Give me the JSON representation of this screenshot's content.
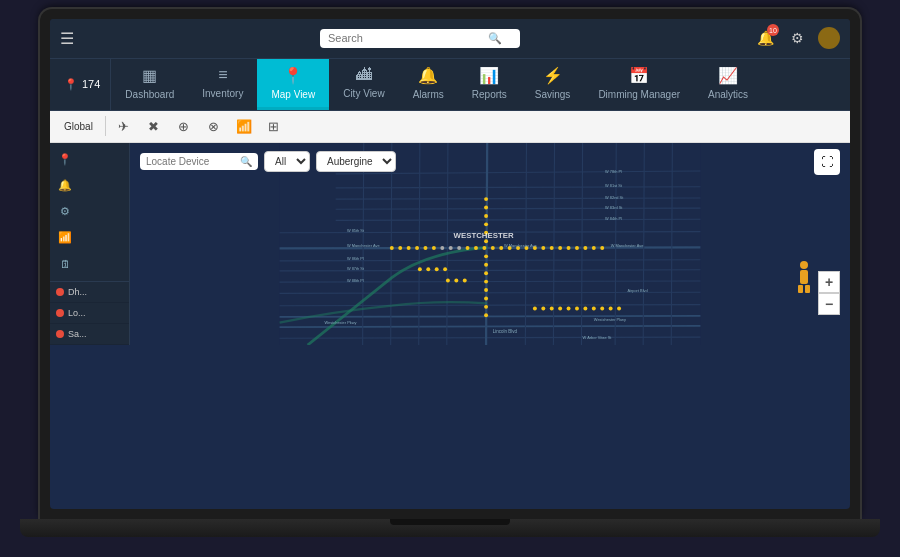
{
  "topbar": {
    "menu_icon": "☰",
    "search_placeholder": "Search",
    "notification_count": "10",
    "icons": [
      "🔍",
      "🔔",
      "⚙",
      "👤"
    ]
  },
  "navtabs": [
    {
      "id": "dashboard",
      "label": "Dashboard",
      "icon": "▦",
      "active": false
    },
    {
      "id": "inventory",
      "label": "Inventory",
      "icon": "≡",
      "active": false
    },
    {
      "id": "mapview",
      "label": "Map View",
      "icon": "📍",
      "active": true
    },
    {
      "id": "cityview",
      "label": "City View",
      "icon": "≡",
      "active": false
    },
    {
      "id": "alarms",
      "label": "Alarms",
      "icon": "🔔",
      "active": false
    },
    {
      "id": "reports",
      "label": "Reports",
      "icon": "📊",
      "active": false
    },
    {
      "id": "savings",
      "label": "Savings",
      "icon": "⚡",
      "active": false
    },
    {
      "id": "dimming",
      "label": "Dimming Manager",
      "icon": "📅",
      "active": false
    },
    {
      "id": "analytics",
      "label": "Analytics",
      "icon": "📈",
      "active": false
    }
  ],
  "location_badge": {
    "icon": "📍",
    "count": "174"
  },
  "toolbar": {
    "global_label": "Global",
    "buttons": [
      "✈",
      "✖",
      "⊕",
      "⊗",
      "📶",
      "⊞"
    ]
  },
  "sidebar": {
    "filter_icons": [
      "📍",
      "🔔",
      "⚙",
      "📶",
      "🗓"
    ],
    "items": [
      {
        "id": "dh",
        "label": "Dh...",
        "color": "#e74c3c"
      },
      {
        "id": "lo",
        "label": "Lo...",
        "color": "#e74c3c"
      },
      {
        "id": "sa",
        "label": "Sa...",
        "color": "#e74c3c"
      }
    ]
  },
  "map": {
    "locate_placeholder": "Locate Device",
    "filter_all_label": "All",
    "filter_color_label": "Aubergine",
    "zoom_in": "+",
    "zoom_out": "−",
    "location_name": "WESTCHESTER",
    "streets": [
      "W 78th Pl",
      "W 81st St",
      "W 82nd St",
      "W 83rd St",
      "W 84th Pl",
      "W 85th St",
      "W Manchester Ave",
      "W 86th Pl",
      "W 87th St",
      "W 88th Pl",
      "Lincoln Blvd",
      "W Arbor Vitae St",
      "Westchester Pkwy",
      "Airport Blvd",
      "Sepulveda Blvd"
    ]
  },
  "colors": {
    "active_tab": "#00bcd4",
    "map_bg": "#1b2a4a",
    "sidebar_bg": "#1e2a3a",
    "street": "#253a5e",
    "street_light": "#2d4a70",
    "dot_yellow": "#f5c518",
    "dot_gray": "#aaaaaa",
    "highlight_road": "#00bcd4"
  }
}
